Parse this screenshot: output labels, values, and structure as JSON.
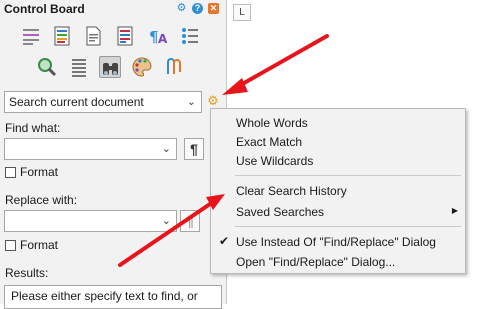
{
  "panel": {
    "title": "Control Board",
    "header_icons": [
      "gear-icon",
      "help-icon",
      "close-icon"
    ],
    "tool_icons_row1": [
      "text-lines-icon",
      "color-document-icon",
      "page-icon",
      "document-list-icon",
      "paragraph-style-icon",
      "list-icon"
    ],
    "tool_icons_row2": [
      "magnifier-icon",
      "align-justify-icon",
      "binoculars-icon",
      "palette-icon",
      "paperclips-icon"
    ],
    "search_scope": "Search current document",
    "find_label": "Find what:",
    "find_value": "",
    "pilcrow": "¶",
    "format_label": "Format",
    "replace_label": "Replace with:",
    "replace_value": "",
    "results_label": "Results:",
    "results_text": "Please either specify text to find, or"
  },
  "document": {
    "corner_glyph": "L"
  },
  "context_menu": {
    "items": [
      {
        "label": "Whole Words",
        "checked": false
      },
      {
        "label": "Exact Match",
        "checked": false
      },
      {
        "label": "Use Wildcards",
        "checked": false
      },
      {
        "label": "Clear Search History",
        "checked": false
      },
      {
        "label": "Saved Searches",
        "checked": false,
        "submenu_glyph": "▶"
      },
      {
        "label": "Use Instead Of \"Find/Replace\" Dialog",
        "checked": true,
        "check_glyph": "✔"
      },
      {
        "label": "Open \"Find/Replace\" Dialog...",
        "checked": false
      }
    ]
  },
  "colors": {
    "accent_blue": "#2f8fd6",
    "accent_orange": "#e8762a",
    "arrow_red": "#e8141c"
  }
}
